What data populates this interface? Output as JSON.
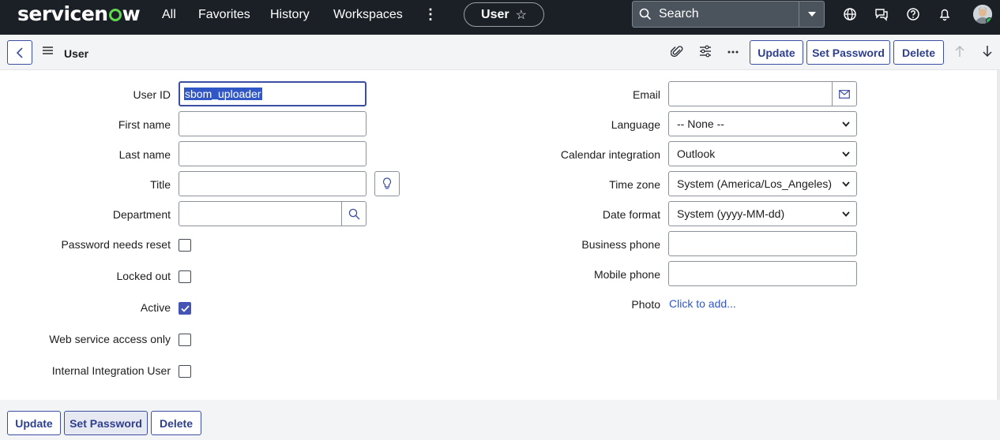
{
  "topnav": {
    "logo_pre": "servicen",
    "logo_post": "w",
    "links": [
      "All",
      "Favorites",
      "History",
      "Workspaces"
    ],
    "context_title": "User",
    "search_placeholder": "Search"
  },
  "header": {
    "title": "User",
    "buttons": {
      "update": "Update",
      "set_password": "Set Password",
      "delete": "Delete"
    }
  },
  "form": {
    "left": {
      "user_id": {
        "label": "User ID",
        "value": "sbom_uploader"
      },
      "first_name": {
        "label": "First name",
        "value": ""
      },
      "last_name": {
        "label": "Last name",
        "value": ""
      },
      "title": {
        "label": "Title",
        "value": ""
      },
      "department": {
        "label": "Department",
        "value": ""
      },
      "password_needs_reset": {
        "label": "Password needs reset",
        "checked": false
      },
      "locked_out": {
        "label": "Locked out",
        "checked": false
      },
      "active": {
        "label": "Active",
        "checked": true
      },
      "web_service_access_only": {
        "label": "Web service access only",
        "checked": false
      },
      "internal_integration_user": {
        "label": "Internal Integration User",
        "checked": false
      }
    },
    "right": {
      "email": {
        "label": "Email",
        "value": ""
      },
      "language": {
        "label": "Language",
        "value": "-- None --"
      },
      "calendar_integration": {
        "label": "Calendar integration",
        "value": "Outlook"
      },
      "time_zone": {
        "label": "Time zone",
        "value": "System (America/Los_Angeles)"
      },
      "date_format": {
        "label": "Date format",
        "value": "System (yyyy-MM-dd)"
      },
      "business_phone": {
        "label": "Business phone",
        "value": ""
      },
      "mobile_phone": {
        "label": "Mobile phone",
        "value": ""
      },
      "photo": {
        "label": "Photo",
        "link": "Click to add..."
      }
    }
  },
  "footer": {
    "buttons": {
      "update": "Update",
      "set_password": "Set Password",
      "delete": "Delete"
    }
  },
  "colors": {
    "nav_bg": "#1b2027",
    "accent": "#3c4ea1",
    "logo_green": "#62d84e",
    "link": "#3157c7"
  }
}
